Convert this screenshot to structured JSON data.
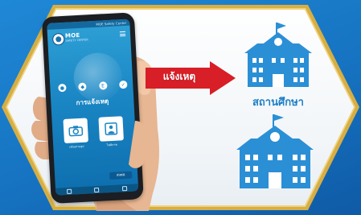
{
  "phone": {
    "status_time": "",
    "status_right": "MOE Safety Center",
    "app_title": "MOE",
    "app_subtitle": "SAFETY CENTER",
    "report_title": "การแจ้งเหตุ",
    "tiles": [
      {
        "label": "กล้องถ่ายรูป",
        "icon": "camera-icon"
      },
      {
        "label": "ไฟล์ภาพ",
        "icon": "gallery-icon"
      }
    ],
    "send_label": "ส่งต่อ",
    "icon_row": [
      "drop-icon",
      "location-pin-icon",
      "e-icon",
      "check-icon"
    ]
  },
  "arrow": {
    "label": "แจ้งเหตุ"
  },
  "schools": {
    "label": "สถานศึกษา"
  },
  "colors": {
    "frame_gold": "#d8b24a",
    "background_blue": "#1673c1",
    "arrow_red": "#d81e26",
    "school_blue": "#2b8fd6"
  }
}
